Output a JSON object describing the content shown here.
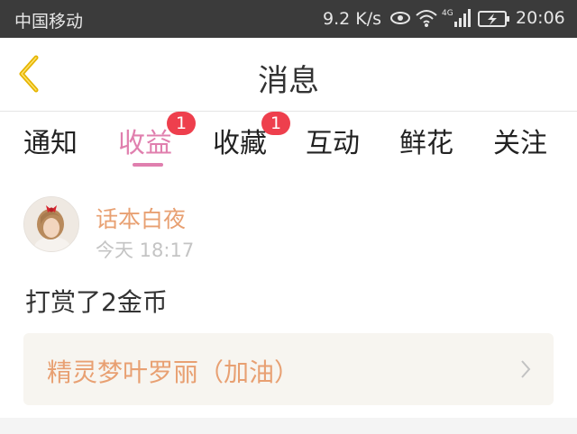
{
  "status_bar": {
    "carrier": "中国移动",
    "network_speed": "9.2 K/s",
    "signal_type": "4G",
    "time": "20:06"
  },
  "header": {
    "title": "消息",
    "back_icon": "chevron-left-icon"
  },
  "tabs": [
    {
      "label": "通知",
      "active": false,
      "badge": ""
    },
    {
      "label": "收益",
      "active": true,
      "badge": "1"
    },
    {
      "label": "收藏",
      "active": false,
      "badge": "1"
    },
    {
      "label": "互动",
      "active": false,
      "badge": ""
    },
    {
      "label": "鲜花",
      "active": false,
      "badge": ""
    },
    {
      "label": "关注",
      "active": false,
      "badge": ""
    }
  ],
  "message": {
    "username": "话本白夜",
    "timestamp": "今天 18:17",
    "text": "打赏了2金币",
    "work_title": "精灵梦叶罗丽（加油）"
  },
  "colors": {
    "accent_pink": "#e07fae",
    "badge_red": "#ee3f4d",
    "name_orange": "#e8a072",
    "back_gold": "#e5b400"
  }
}
